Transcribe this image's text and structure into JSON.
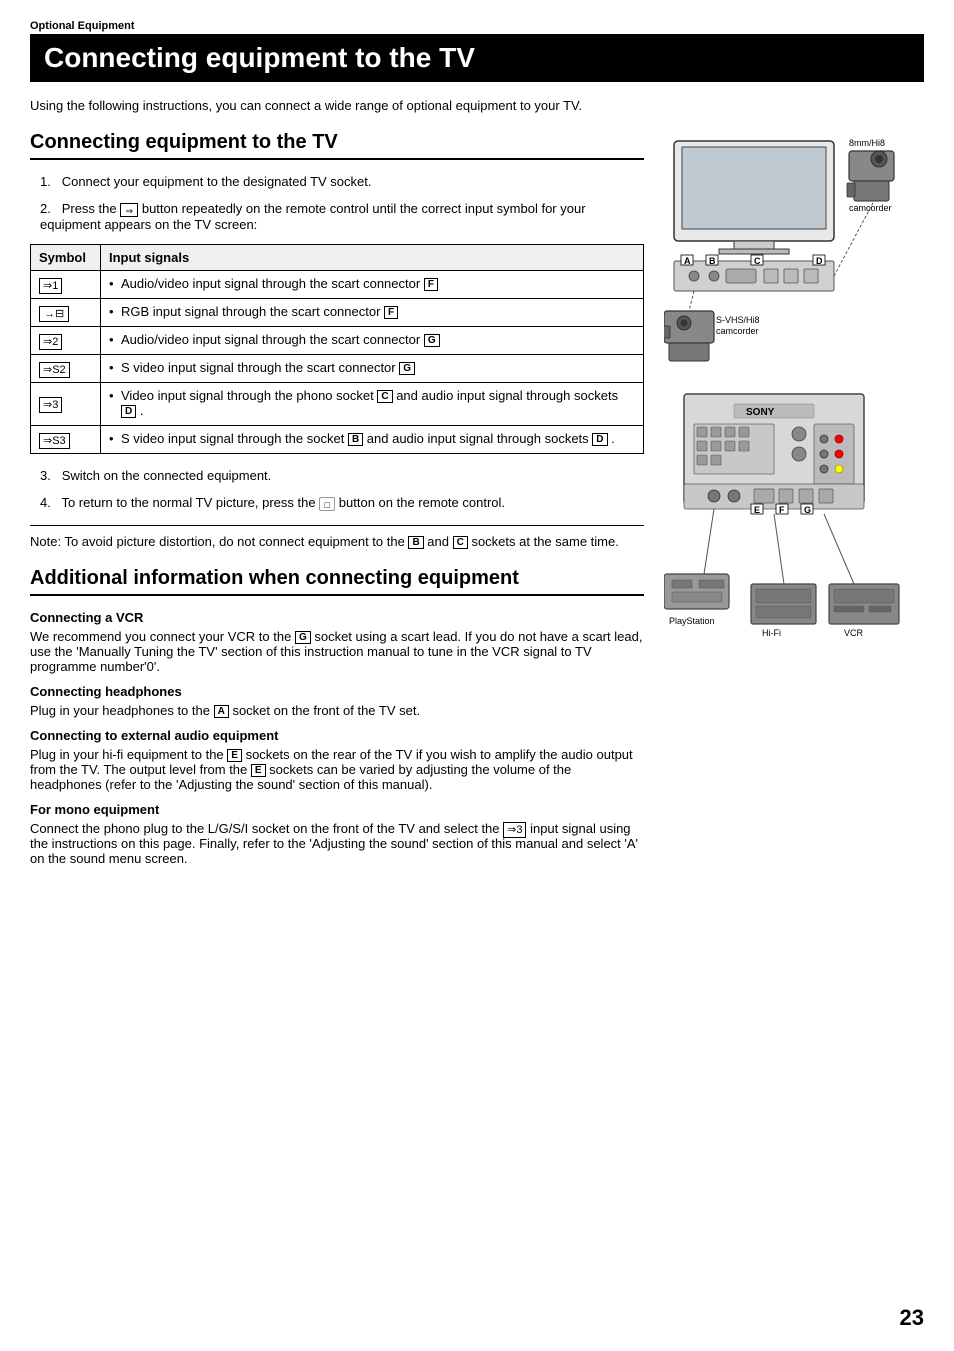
{
  "page": {
    "section_label": "Optional Equipment",
    "main_title": "Connecting equipment to the TV",
    "intro": "Using the following instructions, you can connect a wide range of optional equipment to your TV.",
    "section1_title": "Connecting equipment to the TV",
    "steps": [
      {
        "num": "1.",
        "text": "Connect your equipment to the designated TV socket."
      },
      {
        "num": "2.",
        "text": "Press the",
        "text2": "button repeatedly on the remote control until the correct input symbol for your equipment appears on the TV screen:"
      },
      {
        "num": "3.",
        "text": "Switch on the connected equipment."
      },
      {
        "num": "4.",
        "text": "To return to the normal TV picture, press the",
        "text2": "button on the remote control."
      }
    ],
    "table": {
      "col1": "Symbol",
      "col2": "Input signals",
      "rows": [
        {
          "symbol": "⇒1",
          "signal": "Audio/video input signal through the scart connector",
          "label": "F"
        },
        {
          "symbol": "→⊟",
          "signal": "RGB input signal through the scart connector",
          "label": "F"
        },
        {
          "symbol": "⇒2",
          "signal": "Audio/video input signal through the scart connector",
          "label": "G"
        },
        {
          "symbol": "⇒S2",
          "signal": "S video input signal through the scart connector",
          "label": "G"
        },
        {
          "symbol": "⇒3",
          "signal": "Video input signal through the phono socket",
          "label_inline": "C",
          "text_and": "and audio input signal through sockets",
          "label_inline2": "D",
          "text_end": "."
        },
        {
          "symbol": "⇒S3",
          "signal": "S video input signal through the socket",
          "label_inline": "B",
          "text_and": "and audio input signal through sockets",
          "label_inline2": "D",
          "text_end": "."
        }
      ]
    },
    "note": "Note: To avoid picture distortion, do not connect equipment to the",
    "note_b": "B",
    "note_and": "and",
    "note_c": "C",
    "note_rest": "sockets at the same time.",
    "section2_title": "Additional information when connecting equipment",
    "subsections": [
      {
        "title": "Connecting a VCR",
        "text": "We recommend you connect your VCR to the",
        "label": "G",
        "text2": "socket using a scart lead.  If you do not have a scart lead, use the 'Manually Tuning the TV' section of this instruction manual to tune in the VCR signal to TV programme number'0'."
      },
      {
        "title": "Connecting headphones",
        "text": "Plug in your headphones to the",
        "label": "A",
        "text2": "socket on the front of the TV set."
      },
      {
        "title": "Connecting to external audio equipment",
        "text": "Plug in your hi-fi equipment to the",
        "label": "E",
        "text2": "sockets on the rear of the TV if you wish to amplify the audio output from the TV.  The output level from the",
        "label2": "E",
        "text3": "sockets can be varied by adjusting the volume of the headphones (refer to the 'Adjusting the sound' section of this manual)."
      },
      {
        "title": "For mono equipment",
        "text": "Connect the phono plug to the L/G/S/I socket on the front of the TV and select the ⇒3 input signal using the instructions on this page.  Finally, refer to the 'Adjusting the sound' section of this manual and select 'A' on the sound menu screen."
      }
    ],
    "page_number": "23",
    "diagram_labels": {
      "top_labels": [
        "A",
        "B",
        "C",
        "D"
      ],
      "top_right_label": "8mm/Hi8 camcorder",
      "bottom_right_label": "S-VHS/Hi8 camcorder",
      "bottom_labels": [
        "E",
        "F",
        "G"
      ],
      "bottom_devices": [
        "PlayStation",
        "Hi-Fi",
        "VCR"
      ]
    }
  }
}
